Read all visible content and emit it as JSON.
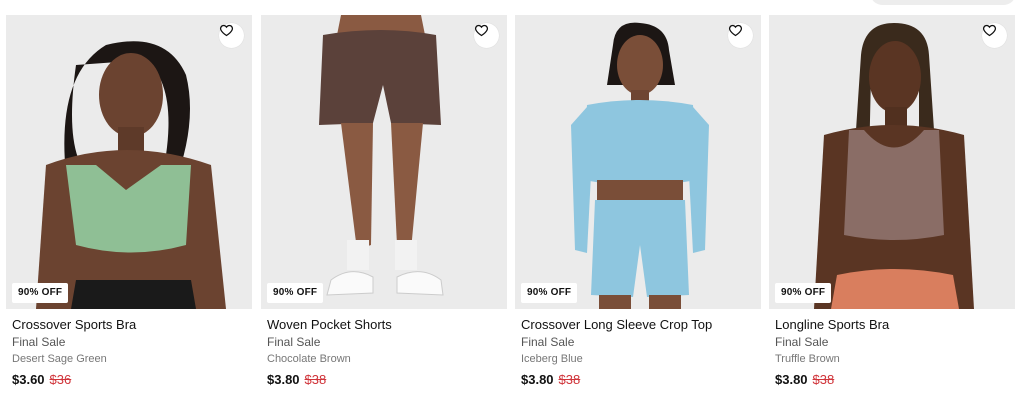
{
  "icons": {
    "wishlist": "heart-outline-icon"
  },
  "colors": {
    "sale_price": "#d0343a",
    "badge_bg": "#ffffff",
    "image_bg": "#eeeeee"
  },
  "products": [
    {
      "badge": "90% OFF",
      "title": "Crossover Sports Bra",
      "status": "Final Sale",
      "color": "Desert Sage Green",
      "price": "$3.60",
      "original_price": "$36"
    },
    {
      "badge": "90% OFF",
      "title": "Woven Pocket Shorts",
      "status": "Final Sale",
      "color": "Chocolate Brown",
      "price": "$3.80",
      "original_price": "$38"
    },
    {
      "badge": "90% OFF",
      "title": "Crossover Long Sleeve Crop Top",
      "status": "Final Sale",
      "color": "Iceberg Blue",
      "price": "$3.80",
      "original_price": "$38"
    },
    {
      "badge": "90% OFF",
      "title": "Longline Sports Bra",
      "status": "Final Sale",
      "color": "Truffle Brown",
      "price": "$3.80",
      "original_price": "$38"
    }
  ]
}
